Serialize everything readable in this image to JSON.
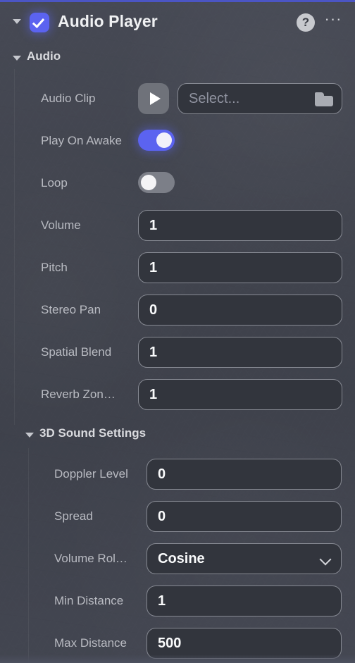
{
  "theme": {
    "accent_top_border": "#4b55c4",
    "toggle_on": "#5b63f0",
    "toggle_off": "#7c7f88",
    "panel_bg": "#42454f",
    "field_bg": "#32353d",
    "field_border": "#868992",
    "label_text": "#b9bbc2",
    "value_text": "#fafbfc"
  },
  "header": {
    "title": "Audio Player",
    "checkbox_checked": true,
    "collapse_arrow": "chevron-down-icon",
    "help_label": "?",
    "more_label": "···"
  },
  "sections": {
    "audio": {
      "label": "Audio",
      "expanded": true
    },
    "sound3d": {
      "label": "3D Sound Settings",
      "expanded": true
    }
  },
  "audio_clip": {
    "label": "Audio Clip",
    "placeholder": "Select...",
    "value": "Select...",
    "play_icon": "play-icon",
    "browse_icon": "folder-icon"
  },
  "toggles": [
    {
      "label": "Play On Awake",
      "state": "on",
      "value": "true"
    },
    {
      "label": "Loop",
      "state": "off",
      "value": "false"
    }
  ],
  "audio_fields": [
    {
      "label": "Volume",
      "value": "1"
    },
    {
      "label": "Pitch",
      "value": "1"
    },
    {
      "label": "Stereo Pan",
      "value": "0"
    },
    {
      "label": "Spatial Blend",
      "value": "1"
    },
    {
      "label": "Reverb Zon…",
      "value": "1"
    }
  ],
  "sound3d_fields": [
    {
      "label": "Doppler Level",
      "value": "0"
    },
    {
      "label": "Spread",
      "value": "0"
    }
  ],
  "volume_rolloff": {
    "label": "Volume Rol…",
    "value": "Cosine",
    "chevron": "chevron-down-icon"
  },
  "distance_fields": [
    {
      "label": "Min Distance",
      "value": "1"
    },
    {
      "label": "Max Distance",
      "value": "500"
    }
  ]
}
